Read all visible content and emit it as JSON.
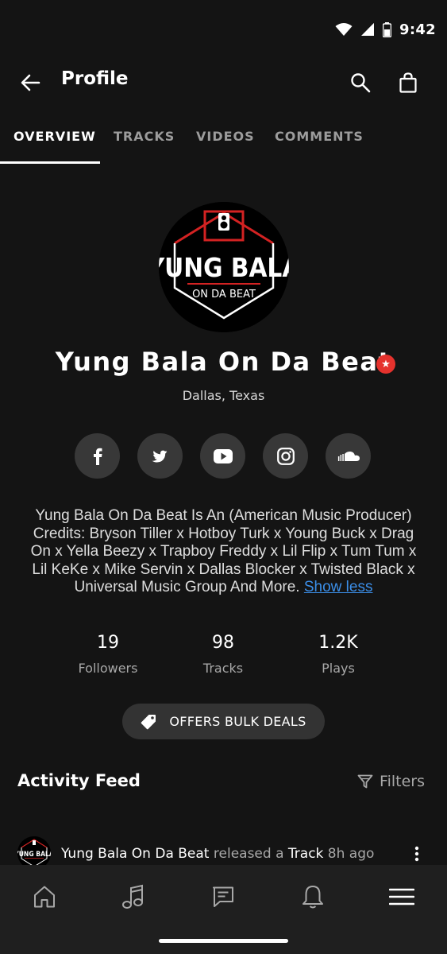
{
  "status_bar": {
    "time": "9:42"
  },
  "app_bar": {
    "title": "Profile"
  },
  "tabs": [
    {
      "label": "OVERVIEW",
      "active": true
    },
    {
      "label": "TRACKS",
      "active": false
    },
    {
      "label": "VIDEOS",
      "active": false
    },
    {
      "label": "COMMENTS",
      "active": false
    }
  ],
  "profile": {
    "avatar_logo": {
      "line1": "YUNG BALA",
      "line2": "ON DA BEAT"
    },
    "name": "Yung Bala On Da Beat",
    "verified_badge": "★",
    "location": "Dallas, Texas",
    "socials": [
      "facebook-icon",
      "twitter-icon",
      "youtube-icon",
      "instagram-icon",
      "soundcloud-icon"
    ],
    "bio": "Yung Bala On Da Beat Is An (American Music Producer) Credits: Bryson Tiller x Hotboy Turk x Young Buck x Drag On x Yella Beezy x Trapboy Freddy x Lil Flip x Tum Tum x Lil KeKe x Mike Servin x Dallas Blocker x Twisted Black x Universal Music Group And More.",
    "show_less": "Show less"
  },
  "stats": [
    {
      "value": "19",
      "label": "Followers"
    },
    {
      "value": "98",
      "label": "Tracks"
    },
    {
      "value": "1.2K",
      "label": "Plays"
    }
  ],
  "bulk_deals_label": "OFFERS BULK DEALS",
  "activity_feed": {
    "title": "Activity Feed",
    "filters_label": "Filters",
    "items": [
      {
        "actor": "Yung Bala On Da Beat",
        "verb": "released a",
        "object": "Track",
        "time": "8h ago"
      }
    ]
  },
  "bottom_nav": [
    "home-icon",
    "music-note-icon",
    "chat-icon",
    "bell-icon",
    "menu-icon"
  ],
  "colors": {
    "background": "#141414",
    "accent_link": "#3b8ee8",
    "badge_red": "#e5322d",
    "chip_bg": "#333333"
  }
}
